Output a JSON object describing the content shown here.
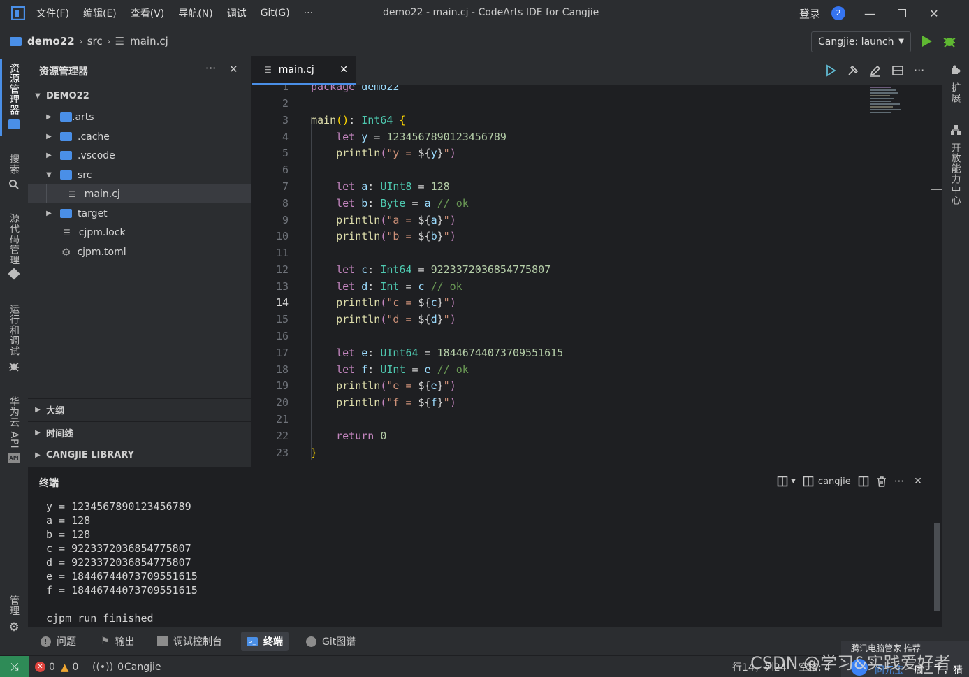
{
  "titlebar": {
    "menus": [
      "文件(F)",
      "编辑(E)",
      "查看(V)",
      "导航(N)",
      "调试",
      "Git(G)",
      "···"
    ],
    "title": "demo22 - main.cj - CodeArts IDE for Cangjie",
    "login": "登录",
    "badge": "2"
  },
  "breadcrumb": {
    "project": "demo22",
    "folder": "src",
    "file": "main.cj"
  },
  "run_config": "Cangjie: launch",
  "activity": {
    "explorer": "资源管理器",
    "search": "搜索",
    "scm": "源代码管理",
    "run_debug": "运行和调试",
    "cloud_api": "华为云 API",
    "manage": "管理"
  },
  "sidebar": {
    "title": "资源管理器",
    "root": "DEMO22",
    "tree": [
      ".arts",
      ".cache",
      ".vscode",
      "src",
      "main.cj",
      "target",
      "cjpm.lock",
      "cjpm.toml"
    ],
    "sections": [
      "大纲",
      "时间线",
      "CANGJIE LIBRARY"
    ]
  },
  "editor": {
    "tab": "main.cj",
    "current_line": "14",
    "lines": [
      {
        "n": "1",
        "t": "package demo22"
      },
      {
        "n": "2",
        "t": ""
      },
      {
        "n": "3",
        "t": "main(): Int64 {"
      },
      {
        "n": "4",
        "t": "    let y = 1234567890123456789"
      },
      {
        "n": "5",
        "t": "    println(\"y = ${y}\")"
      },
      {
        "n": "6",
        "t": ""
      },
      {
        "n": "7",
        "t": "    let a: UInt8 = 128"
      },
      {
        "n": "8",
        "t": "    let b: Byte = a // ok"
      },
      {
        "n": "9",
        "t": "    println(\"a = ${a}\")"
      },
      {
        "n": "10",
        "t": "    println(\"b = ${b}\")"
      },
      {
        "n": "11",
        "t": ""
      },
      {
        "n": "12",
        "t": "    let c: Int64 = 9223372036854775807"
      },
      {
        "n": "13",
        "t": "    let d: Int = c // ok"
      },
      {
        "n": "14",
        "t": "    println(\"c = ${c}\")"
      },
      {
        "n": "15",
        "t": "    println(\"d = ${d}\")"
      },
      {
        "n": "16",
        "t": ""
      },
      {
        "n": "17",
        "t": "    let e: UInt64 = 18446744073709551615"
      },
      {
        "n": "18",
        "t": "    let f: UInt = e // ok"
      },
      {
        "n": "19",
        "t": "    println(\"e = ${e}\")"
      },
      {
        "n": "20",
        "t": "    println(\"f = ${f}\")"
      },
      {
        "n": "21",
        "t": ""
      },
      {
        "n": "22",
        "t": "    return 0"
      },
      {
        "n": "23",
        "t": "}"
      }
    ]
  },
  "rightbar": {
    "extensions": "扩展",
    "dev_center": "开放能力中心"
  },
  "terminal": {
    "title": "终端",
    "profile": "cangjie",
    "output": [
      "y = 1234567890123456789",
      "a = 128",
      "b = 128",
      "c = 9223372036854775807",
      "d = 9223372036854775807",
      "e = 18446744073709551615",
      "f = 18446744073709551615",
      "",
      "cjpm run finished"
    ]
  },
  "panel_tabs": [
    "问题",
    "输出",
    "调试控制台",
    "终端",
    "Git图谱"
  ],
  "statusbar": {
    "errors": "0",
    "warnings": "0",
    "ports": "0",
    "language": "Cangjie",
    "position": "行14，列24",
    "indent": "空格: 4",
    "notice": "腾讯电脑管家 推荐",
    "ad1": "问元宝",
    "ad2": "周二了，猜",
    "watermark": "CSDN @学习&实践爱好者"
  },
  "colors": {
    "accent": "#4a8fe7",
    "run_green": "#5fb832",
    "bg": "#1e1f22",
    "chrome": "#2b2d30"
  }
}
